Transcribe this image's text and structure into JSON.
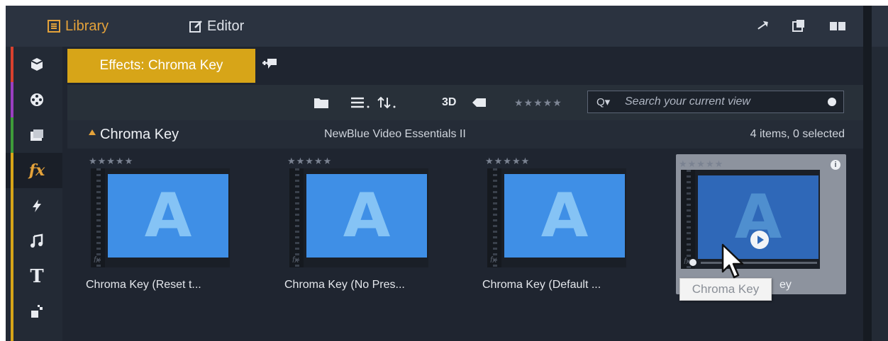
{
  "tabs": {
    "library": "Library",
    "editor": "Editor"
  },
  "header": {
    "icons": [
      "swap-icon",
      "export-icon",
      "layout-icon"
    ]
  },
  "effects_tab": {
    "label": "Effects: Chroma Key"
  },
  "toolbar": {
    "view_3d": "3D",
    "rating_stars": "★★★★★"
  },
  "search": {
    "placeholder": "Search your current view",
    "dropdown": "Q▾"
  },
  "section": {
    "title": "Chroma Key",
    "package": "NewBlue Video Essentials II",
    "count": "4 items, 0 selected"
  },
  "items": [
    {
      "label": "Chroma Key (Reset t...",
      "stars": "★★★★★",
      "thumb_letter": "A"
    },
    {
      "label": "Chroma Key (No Pres...",
      "stars": "★★★★★",
      "thumb_letter": "A"
    },
    {
      "label": "Chroma Key (Default ...",
      "stars": "★★★★★",
      "thumb_letter": "A"
    },
    {
      "label": "Chroma Key",
      "stars": "★★★★★",
      "thumb_letter": "A",
      "label_visible_suffix": "ey"
    }
  ],
  "tooltip": {
    "text": "Chroma Key"
  },
  "nav": {
    "items": [
      "project-bin-icon",
      "media-icon",
      "disc-menu-icon",
      "effects-icon",
      "transitions-icon",
      "audio-icon",
      "titles-icon",
      "montage-icon"
    ],
    "effects_glyph": "fx",
    "titles_glyph": "T"
  },
  "colors": {
    "accent": "#d7a518",
    "library_tab": "#e4a23a",
    "thumbnail_blue": "#3f8fe6",
    "background": "#1f2530"
  }
}
